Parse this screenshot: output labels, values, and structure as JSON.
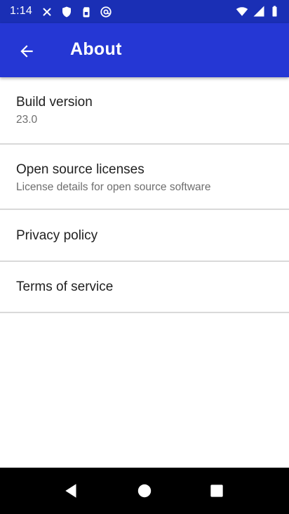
{
  "status_bar": {
    "time": "1:14",
    "left_icons": [
      "close-x-icon",
      "shield-icon",
      "sim-card-icon",
      "at-sign-icon"
    ],
    "right_icons": [
      "wifi-icon",
      "signal-icon",
      "battery-icon"
    ]
  },
  "app_bar": {
    "title": "About",
    "back_icon": "arrow-back-icon"
  },
  "preferences": {
    "build": {
      "title": "Build version",
      "summary": "23.0"
    },
    "licenses": {
      "title": "Open source licenses",
      "summary": "License details for open source software"
    },
    "privacy": {
      "title": "Privacy policy"
    },
    "terms": {
      "title": "Terms of service"
    }
  },
  "nav_bar": {
    "icons": [
      "nav-back-icon",
      "nav-home-icon",
      "nav-recents-icon"
    ]
  },
  "colors": {
    "status_bar": "#1a2fb5",
    "app_bar": "#2537d4",
    "divider": "#d9d9d9",
    "nav_bar": "#000000"
  }
}
